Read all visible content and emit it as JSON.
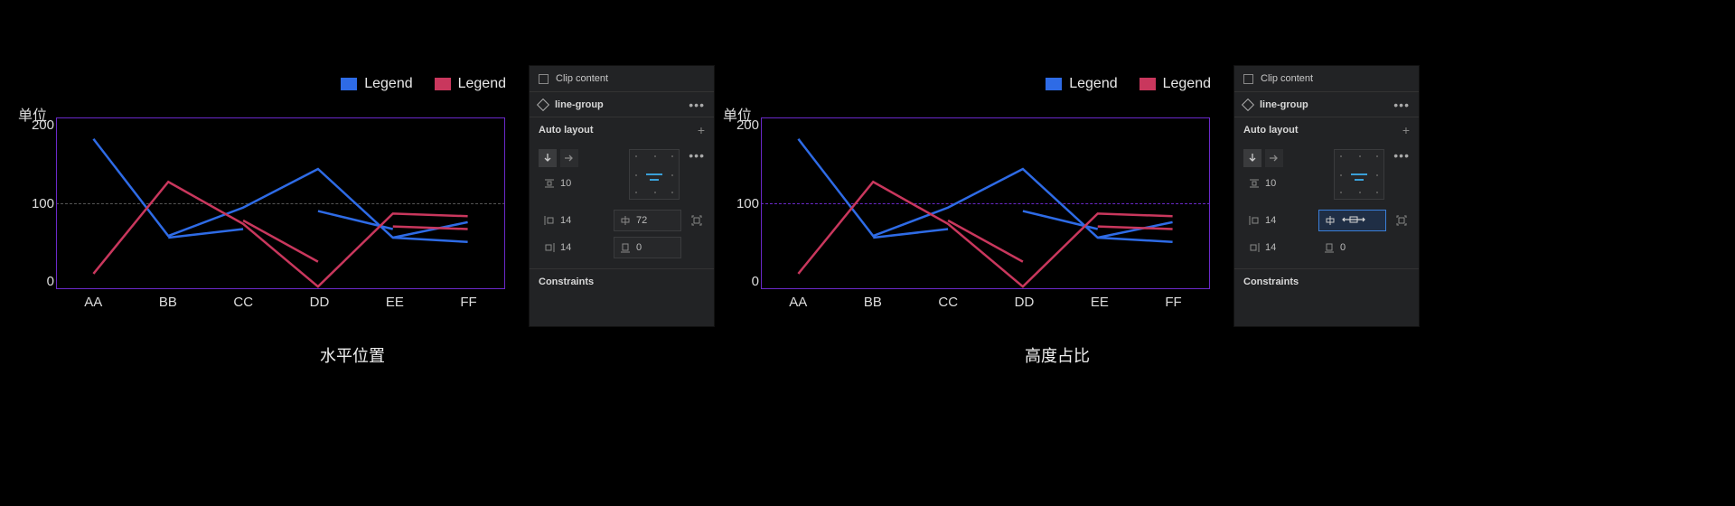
{
  "legend": {
    "a": "Legend",
    "b": "Legend"
  },
  "yunit": "单位",
  "caption_left": "水平位置",
  "caption_right": "高度占比",
  "panel": {
    "clip_content": "Clip content",
    "layer_name": "line-group",
    "auto_layout": "Auto layout",
    "gap_v": "10",
    "pad_l": "14",
    "pad_r": "14",
    "w_left": "72",
    "h_left": "0",
    "w_right": "",
    "h_right": "0",
    "constraints": "Constraints"
  },
  "chart_data": {
    "type": "line",
    "ylabel": "单位",
    "ylim": [
      0,
      200
    ],
    "yticks": [
      200,
      100,
      0
    ],
    "categories": [
      "AA",
      "BB",
      "CC",
      "DD",
      "EE",
      "FF"
    ],
    "series": [
      {
        "name": "Legend",
        "color": "#2e6be6",
        "values": [
          175,
          62,
          95,
          140,
          60,
          55
        ],
        "extra_segments": [
          {
            "from": "BB",
            "to": "CC",
            "v0": 60,
            "v1": 70
          },
          {
            "from": "DD",
            "to": "EE",
            "v0": 91,
            "v1": 70
          },
          {
            "from": "EE",
            "to": "FF",
            "v0": 60,
            "v1": 78
          }
        ]
      },
      {
        "name": "Legend",
        "color": "#c9375d",
        "values": [
          18,
          125,
          76,
          3,
          88,
          85
        ],
        "extra_segments": [
          {
            "from": "CC",
            "to": "DD",
            "v0": 80,
            "v1": 32
          },
          {
            "from": "EE",
            "to": "FF",
            "v0": 73,
            "v1": 70
          }
        ]
      }
    ]
  }
}
